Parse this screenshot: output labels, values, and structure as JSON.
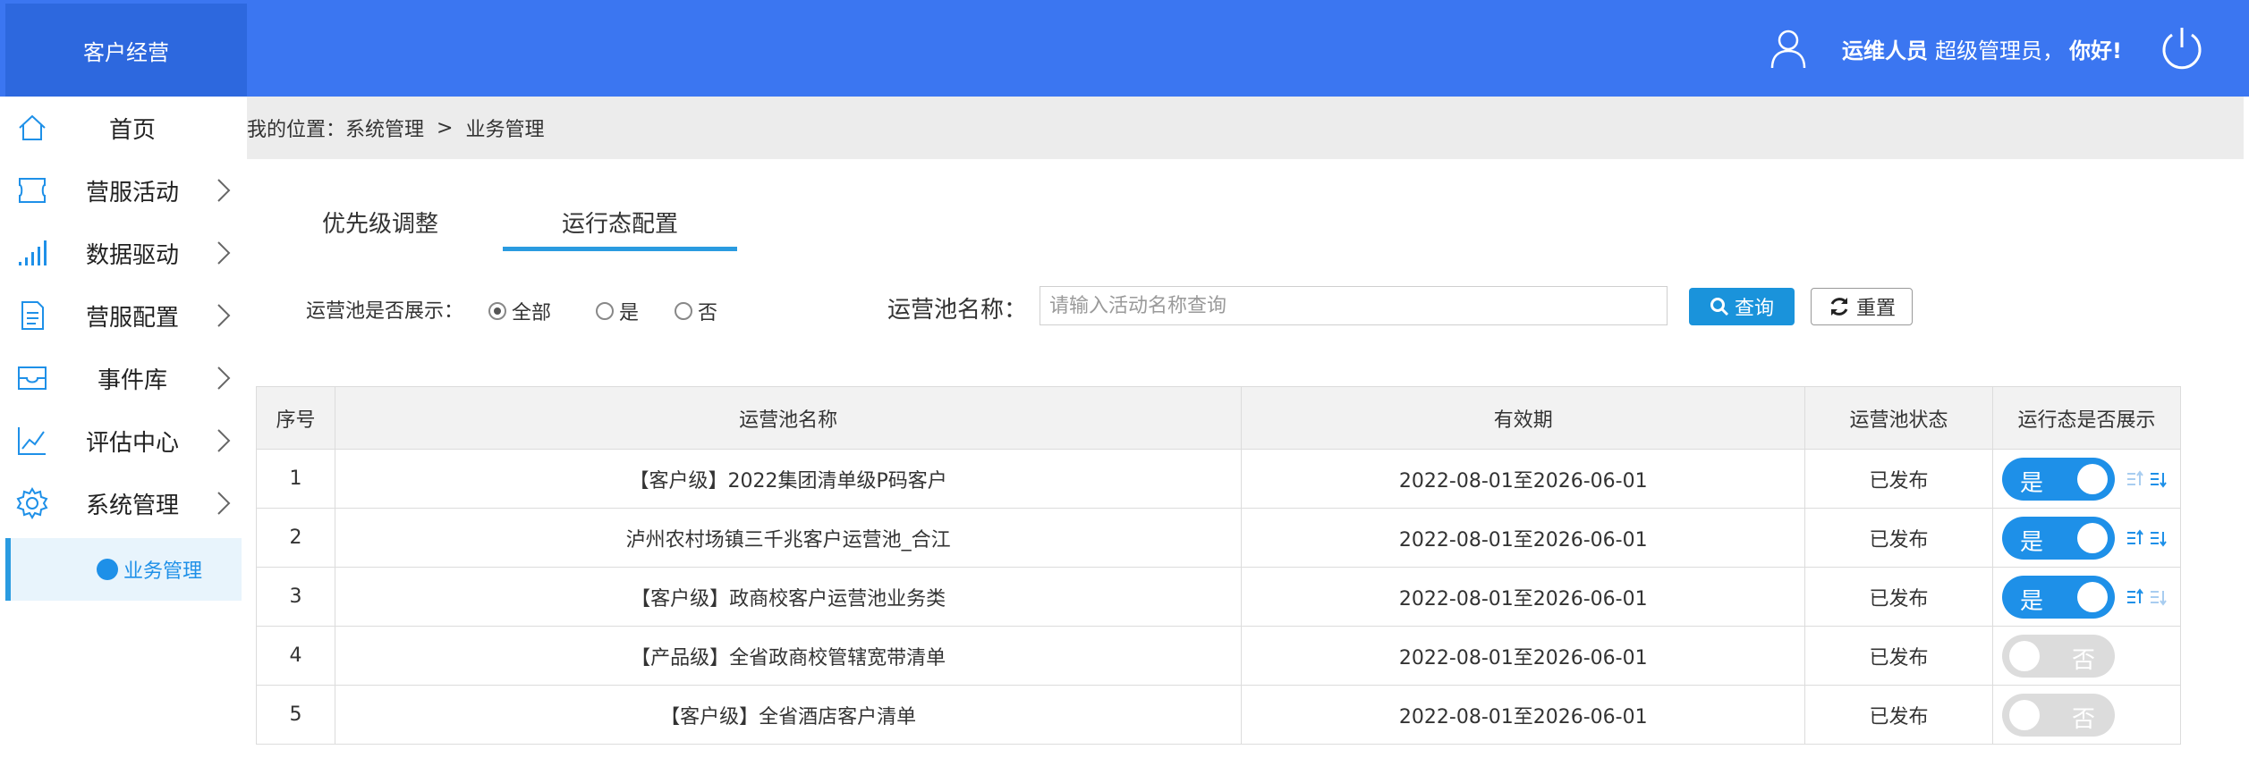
{
  "header": {
    "brand": "客户经营",
    "user_name": "运维人员",
    "user_role": "超级管理员，",
    "user_greeting": "你好!"
  },
  "sidebar": {
    "items": [
      {
        "label": "首页",
        "icon": "home-icon"
      },
      {
        "label": "营服活动",
        "icon": "ticket-icon"
      },
      {
        "label": "数据驱动",
        "icon": "signal-bars-icon"
      },
      {
        "label": "营服配置",
        "icon": "document-icon"
      },
      {
        "label": "事件库",
        "icon": "inbox-icon"
      },
      {
        "label": "评估中心",
        "icon": "chart-trend-icon"
      },
      {
        "label": "系统管理",
        "icon": "gear-icon"
      }
    ],
    "active_sub": "业务管理"
  },
  "breadcrumb": {
    "prefix": "我的位置：",
    "level1": "系统管理",
    "separator": "  >  ",
    "level2": "业务管理"
  },
  "tabs": [
    {
      "label": "优先级调整",
      "active": false
    },
    {
      "label": "运行态配置",
      "active": true
    }
  ],
  "filters": {
    "show_label": "运营池是否展示：",
    "options": [
      "全部",
      "是",
      "否"
    ],
    "selected": "全部",
    "name_label": "运营池名称：",
    "name_placeholder": "请输入活动名称查询",
    "query_button": "查询",
    "reset_button": "重置"
  },
  "table": {
    "columns": [
      "序号",
      "运营池名称",
      "有效期",
      "运营池状态",
      "运行态是否展示"
    ],
    "rows": [
      {
        "index": "1",
        "name": "【客户级】2022集团清单级P码客户",
        "period": "2022-08-01至2026-06-01",
        "status": "已发布",
        "toggle": "是",
        "on": true
      },
      {
        "index": "2",
        "name": "泸州农村场镇三千兆客户运营池_合江",
        "period": "2022-08-01至2026-06-01",
        "status": "已发布",
        "toggle": "是",
        "on": true
      },
      {
        "index": "3",
        "name": "【客户级】政商校客户运营池业务类",
        "period": "2022-08-01至2026-06-01",
        "status": "已发布",
        "toggle": "是",
        "on": true
      },
      {
        "index": "4",
        "name": "【产品级】全省政商校管辖宽带清单",
        "period": "2022-08-01至2026-06-01",
        "status": "已发布",
        "toggle": "否",
        "on": false
      },
      {
        "index": "5",
        "name": "【客户级】全省酒店客户清单",
        "period": "2022-08-01至2026-06-01",
        "status": "已发布",
        "toggle": "否",
        "on": false
      }
    ]
  },
  "colors": {
    "header_bg": "#3b76f1",
    "brand_bg": "#2d68de",
    "accent": "#1e90e8"
  }
}
